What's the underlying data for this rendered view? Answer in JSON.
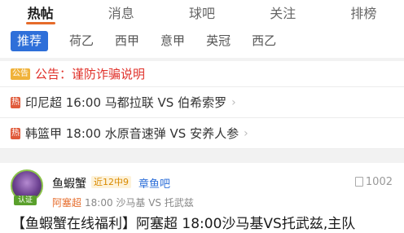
{
  "top_tabs": [
    "热帖",
    "消息",
    "球吧",
    "关注",
    "排榜"
  ],
  "sub_tabs": [
    "推荐",
    "荷乙",
    "西甲",
    "意甲",
    "英冠",
    "西乙"
  ],
  "notice": {
    "badge": "公告",
    "text": "公告：谨防诈骗说明"
  },
  "matches": [
    {
      "badge": "热",
      "text": "印尼超 16:00 马都拉联 VS 伯希索罗"
    },
    {
      "badge": "热",
      "text": "韩篮甲 18:00 水原音速弹 VS 安养人参"
    }
  ],
  "post": {
    "user": "鱼蝦蟹",
    "avatar_tag": "认证",
    "badge": "近12中9",
    "bar": "章鱼吧",
    "views": "1002",
    "league": "阿塞超",
    "meta": "18:00 沙马基 VS 托武兹",
    "title": "【鱼蝦蟹在线福利】阿塞超 18:00沙马基VS托武兹,主队"
  },
  "colors": {
    "accent": "#e66b2a",
    "tab_blue": "#2e6fd9",
    "notice_red": "#e0322b"
  }
}
